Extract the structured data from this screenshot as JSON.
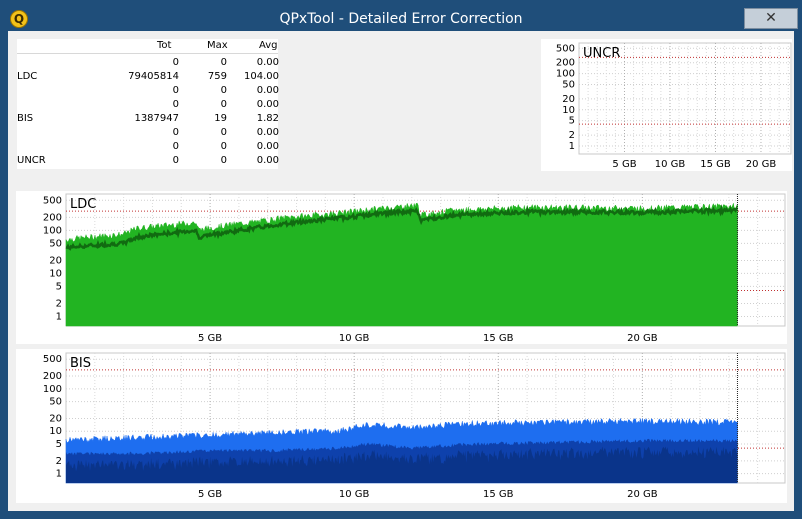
{
  "window": {
    "title": "QPxTool - Detailed Error Correction",
    "app_icon": "Q",
    "close_glyph": "✕"
  },
  "stats": {
    "headers": [
      "Tot",
      "Max",
      "Avg"
    ],
    "rows": [
      {
        "label": "",
        "tot": "0",
        "max": "0",
        "avg": "0.00"
      },
      {
        "label": "LDC",
        "tot": "79405814",
        "max": "759",
        "avg": "104.00"
      },
      {
        "label": "",
        "tot": "0",
        "max": "0",
        "avg": "0.00"
      },
      {
        "label": "",
        "tot": "0",
        "max": "0",
        "avg": "0.00"
      },
      {
        "label": "BIS",
        "tot": "1387947",
        "max": "19",
        "avg": "1.82"
      },
      {
        "label": "",
        "tot": "0",
        "max": "0",
        "avg": "0.00"
      },
      {
        "label": "",
        "tot": "0",
        "max": "0",
        "avg": "0.00"
      },
      {
        "label": "UNCR",
        "tot": "0",
        "max": "0",
        "avg": "0.00"
      }
    ]
  },
  "chart_data": [
    {
      "name": "UNCR",
      "type": "area",
      "title": "UNCR",
      "y_scale": "log",
      "y_ticks": [
        "500",
        "200",
        "100",
        "50",
        "20",
        "10",
        "5",
        "2",
        "1"
      ],
      "x_ticks": [
        "5 GB",
        "10 GB",
        "15 GB",
        "20 GB"
      ],
      "x_range_gb": [
        0,
        23.3
      ],
      "thresholds": [
        280,
        4
      ],
      "series": [
        {
          "values": []
        }
      ]
    },
    {
      "name": "LDC",
      "type": "area",
      "title": "LDC",
      "y_scale": "log",
      "y_ticks": [
        "500",
        "200",
        "100",
        "50",
        "20",
        "10",
        "5",
        "2",
        "1"
      ],
      "x_ticks": [
        "5 GB",
        "10 GB",
        "15 GB",
        "20 GB"
      ],
      "x_range_gb": [
        0,
        24.95
      ],
      "data_end_gb": 23.3,
      "thresholds": [
        280,
        4
      ],
      "colors": {
        "max": "#22b422",
        "avg": "#116b11"
      },
      "series": [
        {
          "x": [
            0,
            2,
            2.5,
            4.5,
            4.6,
            5.8,
            6.8,
            7.5,
            9.0,
            10.0,
            11.0,
            12.2,
            12.3,
            13.5,
            16.0,
            20.0,
            23.2
          ],
          "max": [
            60,
            80,
            110,
            150,
            100,
            135,
            160,
            190,
            230,
            270,
            320,
            380,
            220,
            290,
            340,
            320,
            360
          ],
          "avg": [
            40,
            50,
            70,
            100,
            70,
            95,
            120,
            140,
            180,
            210,
            250,
            280,
            170,
            230,
            270,
            265,
            290
          ]
        }
      ]
    },
    {
      "name": "BIS",
      "type": "area",
      "title": "BIS",
      "y_scale": "log",
      "y_ticks": [
        "500",
        "200",
        "100",
        "50",
        "20",
        "10",
        "5",
        "2",
        "1"
      ],
      "x_ticks": [
        "5 GB",
        "10 GB",
        "15 GB",
        "20 GB"
      ],
      "x_range_gb": [
        0,
        24.95
      ],
      "data_end_gb": 23.3,
      "thresholds": [
        280,
        4
      ],
      "colors": {
        "max": "#1e6ef0",
        "avg": "#0c3aa0",
        "low": "#082a70"
      },
      "series": [
        {
          "x": [
            0,
            2.5,
            5,
            7,
            9.5,
            10.5,
            12,
            14,
            17,
            20,
            23.2
          ],
          "max": [
            6,
            7,
            8,
            9,
            10,
            14,
            12,
            15,
            16,
            17,
            16
          ],
          "avg": [
            3,
            3,
            3.5,
            3.5,
            4,
            5,
            4,
            5,
            5.5,
            6,
            6
          ]
        }
      ]
    }
  ]
}
